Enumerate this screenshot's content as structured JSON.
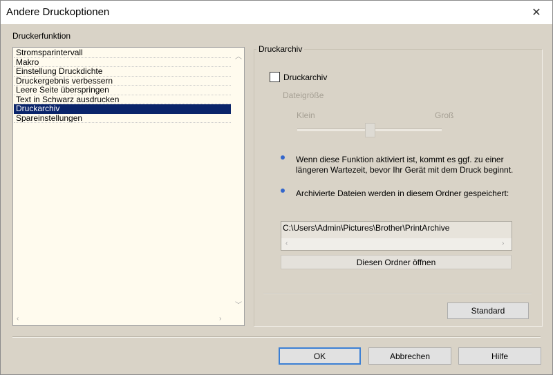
{
  "window": {
    "title": "Andere Druckoptionen",
    "close_glyph": "✕"
  },
  "left": {
    "section_label": "Druckerfunktion",
    "items": [
      {
        "label": "Stromsparintervall",
        "selected": false
      },
      {
        "label": "Makro",
        "selected": false
      },
      {
        "label": "Einstellung Druckdichte",
        "selected": false
      },
      {
        "label": "Druckergebnis verbessern",
        "selected": false
      },
      {
        "label": "Leere Seite überspringen",
        "selected": false
      },
      {
        "label": "Text in Schwarz ausdrucken",
        "selected": false
      },
      {
        "label": "Druckarchiv",
        "selected": true
      },
      {
        "label": "Spareinstellungen",
        "selected": false
      }
    ]
  },
  "right": {
    "group_title": "Druckarchiv",
    "checkbox_label": "Druckarchiv",
    "checkbox_checked": false,
    "file_size_label": "Dateigröße",
    "slider_min_label": "Klein",
    "slider_max_label": "Groß",
    "info1": "Wenn diese Funktion aktiviert ist, kommt es ggf. zu einer längeren Wartezeit, bevor Ihr Gerät mit dem Druck beginnt.",
    "info2": "Archivierte Dateien werden in diesem Ordner gespeichert:",
    "folder_path": "C:\\Users\\Admin\\Pictures\\Brother\\PrintArchive",
    "open_folder_button": "Diesen Ordner öffnen",
    "standard_button": "Standard"
  },
  "footer": {
    "ok": "OK",
    "cancel": "Abbrechen",
    "help": "Hilfe"
  }
}
